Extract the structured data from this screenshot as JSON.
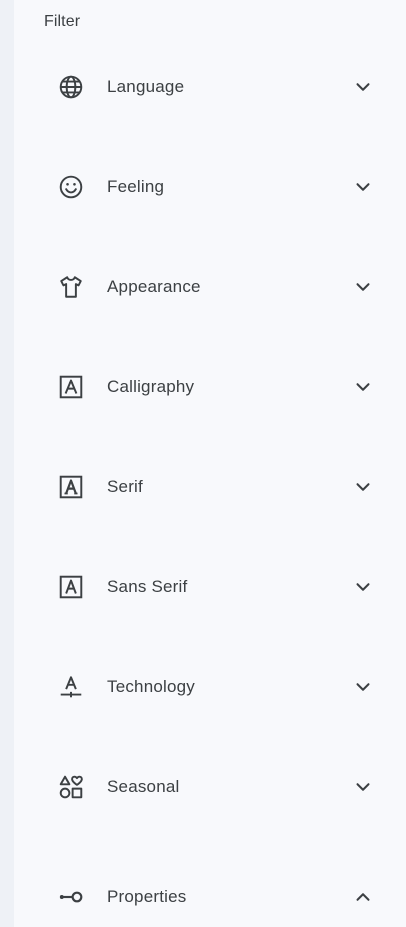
{
  "panel": {
    "title": "Filter"
  },
  "items": [
    {
      "label": "Language",
      "icon": "globe-icon",
      "expanded": false
    },
    {
      "label": "Feeling",
      "icon": "smiley-icon",
      "expanded": false
    },
    {
      "label": "Appearance",
      "icon": "shirt-icon",
      "expanded": false
    },
    {
      "label": "Calligraphy",
      "icon": "calligraphy-icon",
      "expanded": false
    },
    {
      "label": "Serif",
      "icon": "serif-icon",
      "expanded": false
    },
    {
      "label": "Sans Serif",
      "icon": "sans-serif-icon",
      "expanded": false
    },
    {
      "label": "Technology",
      "icon": "technology-icon",
      "expanded": false
    },
    {
      "label": "Seasonal",
      "icon": "shapes-icon",
      "expanded": false
    },
    {
      "label": "Properties",
      "icon": "properties-icon",
      "expanded": true
    }
  ]
}
